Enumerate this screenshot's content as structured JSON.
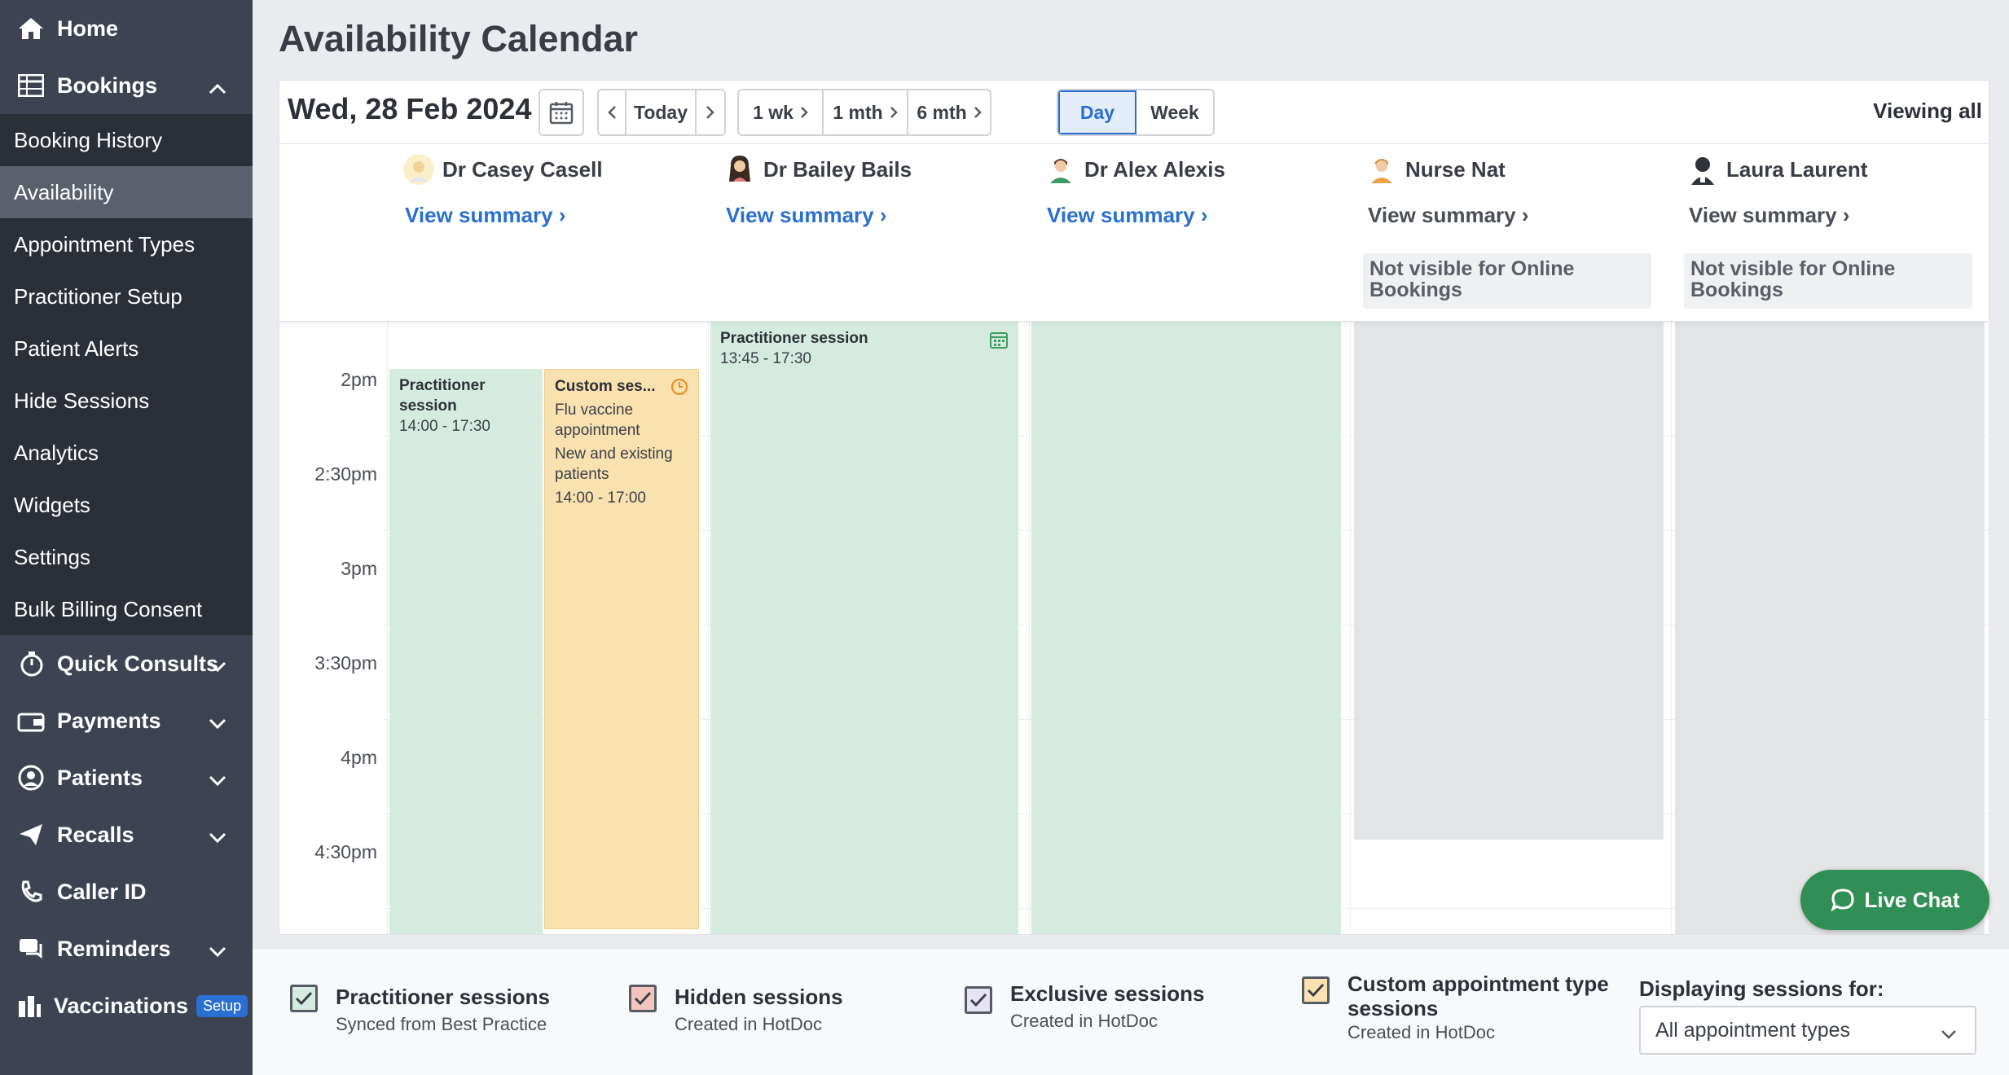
{
  "sidebar": {
    "home": "Home",
    "bookings": "Bookings",
    "booking_items": [
      "Booking History",
      "Availability",
      "Appointment Types",
      "Practitioner Setup",
      "Patient Alerts",
      "Hide Sessions",
      "Analytics",
      "Widgets",
      "Settings",
      "Bulk Billing Consent"
    ],
    "active_item": "Availability",
    "groups": [
      "Quick Consults",
      "Payments",
      "Patients",
      "Recalls",
      "Caller ID",
      "Reminders",
      "Vaccinations"
    ],
    "vaccinations_badge": "Setup"
  },
  "page": {
    "title": "Availability Calendar"
  },
  "toolbar": {
    "date": "Wed, 28 Feb 2024",
    "today": "Today",
    "ranges": [
      "1 wk",
      "1 mth",
      "6 mth"
    ],
    "views": [
      "Day",
      "Week"
    ],
    "active_view": "Day",
    "viewing": "Viewing all"
  },
  "practitioners": [
    {
      "name": "Dr Casey Casell",
      "summary": "View summary",
      "note": ""
    },
    {
      "name": "Dr Bailey Bails",
      "summary": "View summary",
      "note": ""
    },
    {
      "name": "Dr Alex Alexis",
      "summary": "View summary",
      "note": ""
    },
    {
      "name": "Nurse Nat",
      "summary": "View summary",
      "note": "Not visible for Online Bookings"
    },
    {
      "name": "Laura Laurent",
      "summary": "View summary",
      "note": "Not visible for Online Bookings"
    }
  ],
  "times": [
    "2pm",
    "2:30pm",
    "3pm",
    "3:30pm",
    "4pm",
    "4:30pm"
  ],
  "sessions": {
    "casey_pract_title": "Practitioner session",
    "casey_pract_time": "14:00 - 17:30",
    "casey_custom_title": "Custom ses...",
    "casey_custom_line1": "Flu vaccine appointment",
    "casey_custom_line2": "New and existing patients",
    "casey_custom_time": "14:00 - 17:00",
    "bailey_title": "Practitioner session",
    "bailey_time": "13:45 - 17:30"
  },
  "live_chat": "Live Chat",
  "legend": {
    "items": [
      {
        "title": "Practitioner sessions",
        "sub": "Synced from Best Practice",
        "color": "#d6ebdf"
      },
      {
        "title": "Hidden sessions",
        "sub": "Created in HotDoc",
        "color": "#f2c4bd"
      },
      {
        "title": "Exclusive sessions",
        "sub": "Created in HotDoc",
        "color": "#e6e3f5"
      },
      {
        "title": "Custom appointment type sessions",
        "sub": "Created in HotDoc",
        "color": "#fae1b0"
      }
    ],
    "displaying_label": "Displaying sessions for:",
    "select_value": "All appointment types"
  }
}
